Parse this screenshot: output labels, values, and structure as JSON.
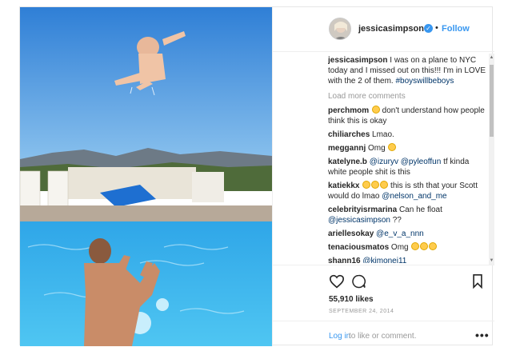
{
  "header": {
    "username": "jessicasimpson",
    "separator": "•",
    "follow_label": "Follow"
  },
  "caption": {
    "username": "jessicasimpson",
    "text": " I was on a plane to NYC today and I missed out on this!!! I'm in LOVE with the 2 of them. ",
    "hashtag": "#boyswillbeboys"
  },
  "load_more_label": "Load more comments",
  "comments": [
    {
      "user": "perchmom",
      "pre": "",
      "text": " don't understand how people think this is okay",
      "mentions": []
    },
    {
      "user": "chiliarches",
      "text": " Lmao."
    },
    {
      "user": "meggannj",
      "text": " Omg "
    },
    {
      "user": "katelyne.b",
      "pre": " ",
      "mention1": "@izuryv",
      "mid": " ",
      "mention2": "@pyleoffun",
      "text": " tf kinda white people shit is this"
    },
    {
      "user": "katiekkx",
      "text": " this is sth that your Scott would do lmao ",
      "mention1": "@nelson_and_me"
    },
    {
      "user": "celebrityisrmarina",
      "text": " Can he float ",
      "mention1": "@jessicasimpson",
      "post": " ??"
    },
    {
      "user": "ariellesokay",
      "mention1": "@e_v_a_nnn"
    },
    {
      "user": "tenaciousmatos",
      "text": " Omg "
    },
    {
      "user": "shann16",
      "mention1": "@kimonei11"
    }
  ],
  "likes": "55,910 likes",
  "date": "SEPTEMBER 24, 2014",
  "footer": {
    "login_label": "Log in",
    "text": " to like or comment.",
    "more_label": "•••"
  },
  "icons": {
    "verified": "verified-badge-icon",
    "heart": "heart-outline-icon",
    "comment": "comment-bubble-icon",
    "bookmark": "bookmark-icon",
    "more": "more-options-icon"
  },
  "colors": {
    "link": "#3897f0",
    "text": "#262626",
    "muted": "#999999"
  }
}
